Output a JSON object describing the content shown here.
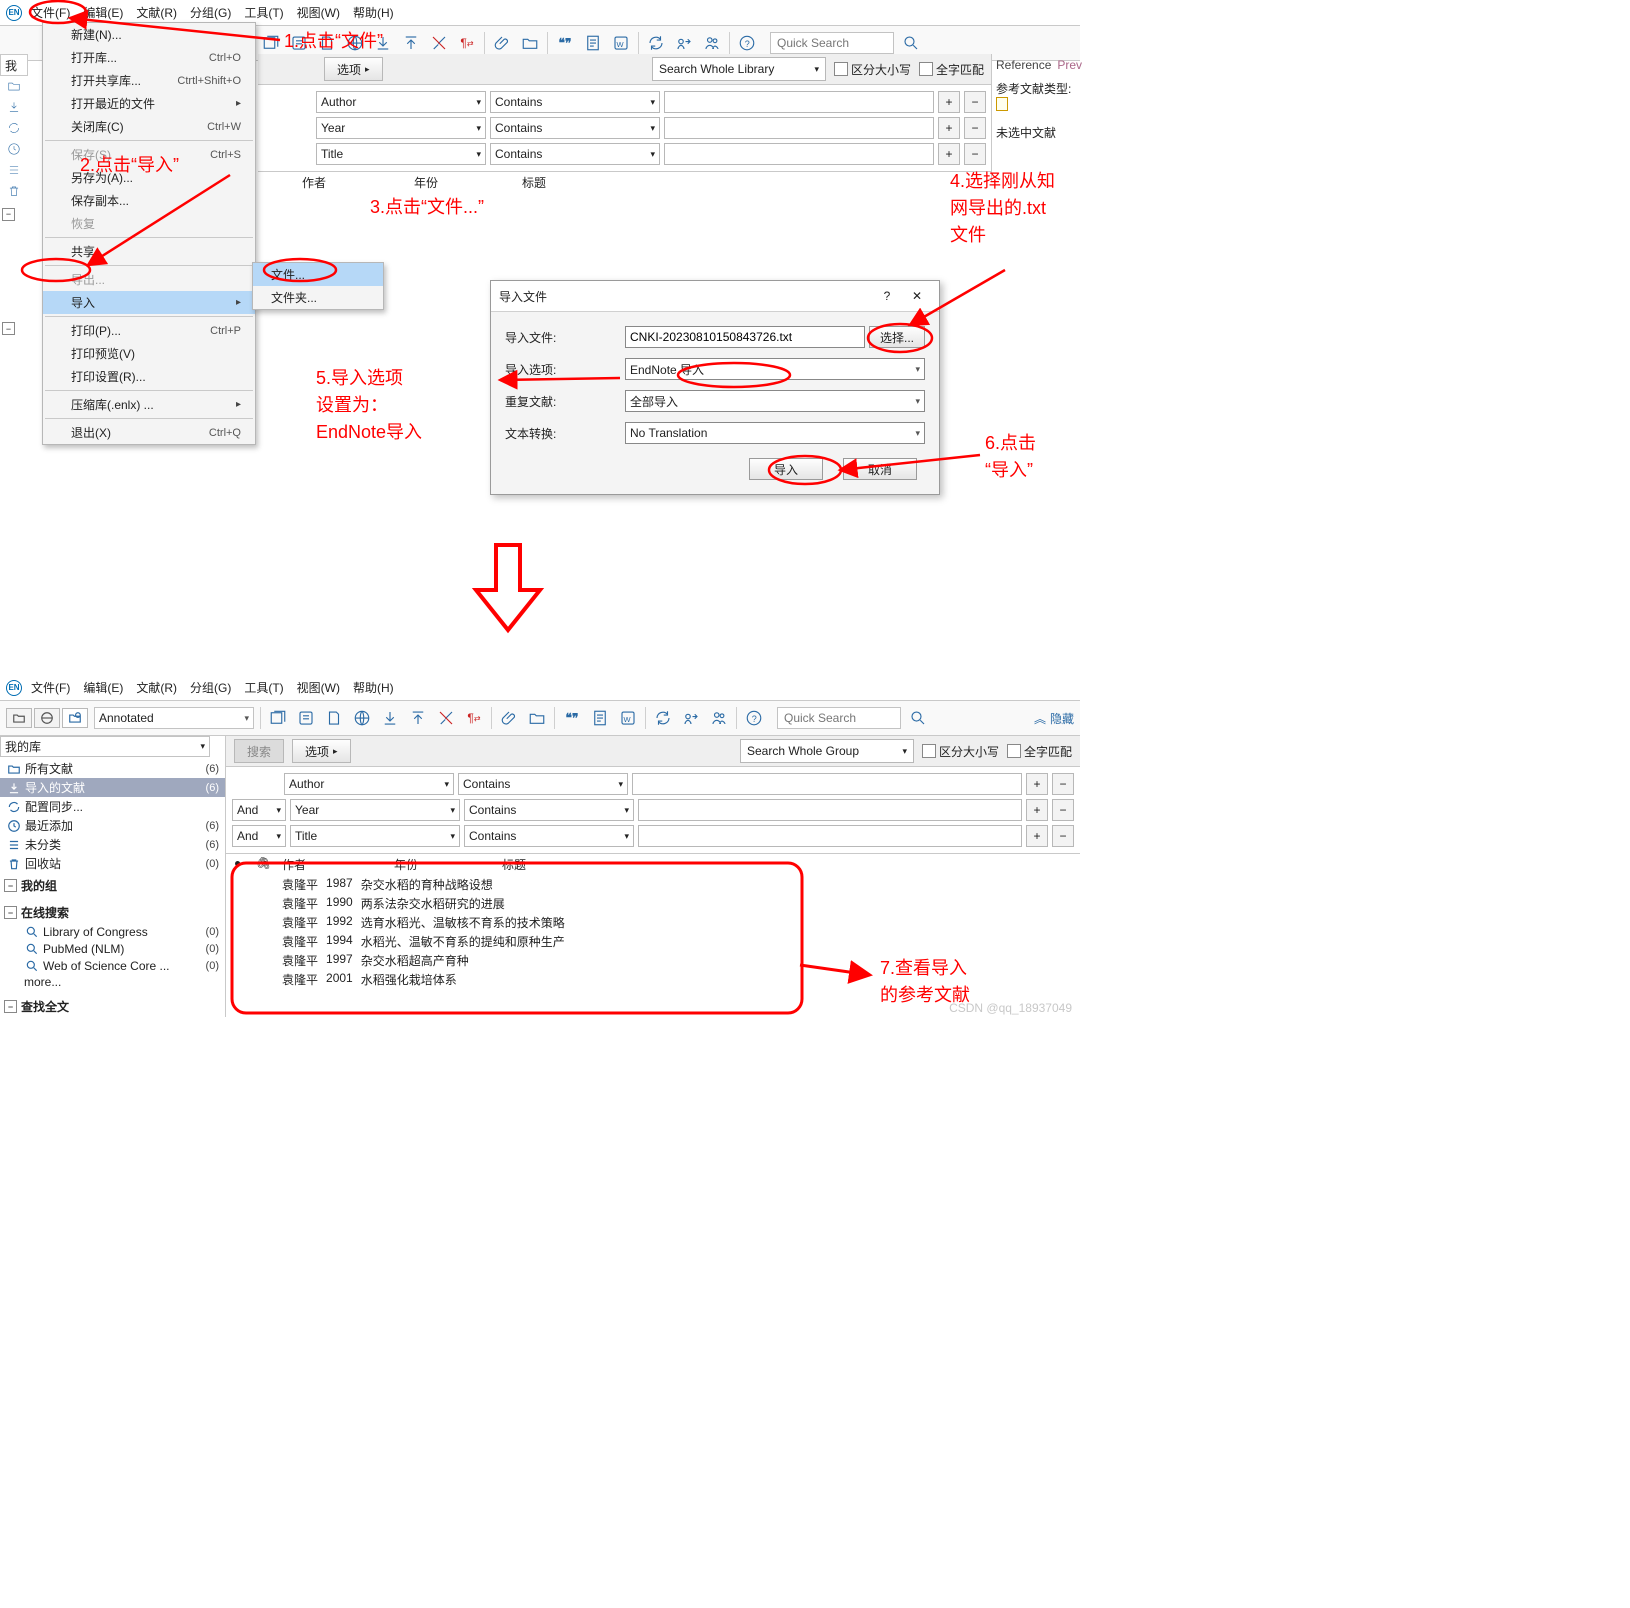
{
  "menus": {
    "file": "文件(F)",
    "edit": "编辑(E)",
    "refs": "文献(R)",
    "group": "分组(G)",
    "tools": "工具(T)",
    "window": "视图(W)",
    "help": "帮助(H)"
  },
  "mode_label": "Annotated",
  "quick_search_placeholder": "Quick Search",
  "file_menu": {
    "new": "新建(N)...",
    "open": "打开库...",
    "open_shared": "打开共享库...",
    "open_recent": "打开最近的文件",
    "close": "关闭库(C)",
    "save": "保存(S)",
    "saveas": "另存为(A)...",
    "savecopy": "保存副本...",
    "revert": "恢复",
    "share": "共享...",
    "export": "导出...",
    "import": "导入",
    "print": "打印(P)...",
    "print_preview": "打印预览(V)",
    "page_setup": "打印设置(R)...",
    "compress": "压缩库(.enlx) ...",
    "exit": "退出(X)",
    "sc_open": "Ctrl+O",
    "sc_open_shared": "Ctrtl+Shift+O",
    "sc_close": "Ctrl+W",
    "sc_save": "Ctrl+S",
    "sc_print": "Ctrl+P",
    "sc_exit": "Ctrl+Q"
  },
  "submenu": {
    "file": "文件...",
    "folder": "文件夹..."
  },
  "searchbar": {
    "search_btn": "搜索",
    "options_btn": "选项",
    "scope1": "Search Whole Library",
    "scope2": "Search Whole Group",
    "match_case": "区分大小写",
    "match_word": "全字匹配"
  },
  "criteria": {
    "field1": "Author",
    "field2": "Year",
    "field3": "Title",
    "op": "Contains",
    "and": "And"
  },
  "columns": {
    "c0": "",
    "attach": "📎",
    "author": "作者",
    "year": "年份",
    "title": "标题"
  },
  "refpane": {
    "tab_ref": "Reference",
    "tab_prev": "Prev",
    "ref_type": "参考文献类型:",
    "no_sel": "未选中文献"
  },
  "dialog": {
    "title": "导入文件",
    "lbl_file": "导入文件:",
    "lbl_opt": "导入选项:",
    "lbl_dup": "重复文献:",
    "lbl_trans": "文本转换:",
    "file_value": "CNKI-20230810150843726.txt",
    "choose": "选择...",
    "opt_value": "EndNote 导入",
    "dup_value": "全部导入",
    "trans_value": "No Translation",
    "btn_import": "导入",
    "btn_cancel": "取消",
    "qmark": "?",
    "close": "✕"
  },
  "annotations": {
    "a1": "1.点击“文件”",
    "a2": "2.点击“导入”",
    "a3": "3.点击“文件...”",
    "a4_l1": "4.选择刚从知",
    "a4_l2": "网导出的.txt",
    "a4_l3": "文件",
    "a5_l1": "5.导入选项",
    "a5_l2": "设置为：",
    "a5_l3": "EndNote导入",
    "a6_l1": "6.点击",
    "a6_l2": "“导入”",
    "a7_l1": "7.查看导入",
    "a7_l2": "的参考文献"
  },
  "sidebar": {
    "mylib": "我的库",
    "hide": "隐藏",
    "items": [
      {
        "icon": "all",
        "label": "所有文献",
        "cnt": "(6)"
      },
      {
        "icon": "imported",
        "label": "导入的文献",
        "cnt": "(6)",
        "sel": true
      },
      {
        "icon": "sync",
        "label": "配置同步..."
      },
      {
        "icon": "recent",
        "label": "最近添加",
        "cnt": "(6)"
      },
      {
        "icon": "unfiled",
        "label": "未分类",
        "cnt": "(6)"
      },
      {
        "icon": "trash",
        "label": "回收站",
        "cnt": "(0)"
      }
    ],
    "mygroups": "我的组",
    "online": "在线搜索",
    "more": "more...",
    "findft": "查找全文",
    "online_items": [
      {
        "label": "Library of Congress",
        "cnt": "(0)"
      },
      {
        "label": "PubMed (NLM)",
        "cnt": "(0)"
      },
      {
        "label": "Web of Science Core ...",
        "cnt": "(0)"
      }
    ]
  },
  "records": [
    {
      "author": "袁隆平",
      "year": "1987",
      "title": "杂交水稻的育种战略设想"
    },
    {
      "author": "袁隆平",
      "year": "1990",
      "title": "两系法杂交水稻研究的进展"
    },
    {
      "author": "袁隆平",
      "year": "1992",
      "title": "选育水稻光、温敏核不育系的技术策略"
    },
    {
      "author": "袁隆平",
      "year": "1994",
      "title": "水稻光、温敏不育系的提纯和原种生产"
    },
    {
      "author": "袁隆平",
      "year": "1997",
      "title": "杂交水稻超高产育种"
    },
    {
      "author": "袁隆平",
      "year": "2001",
      "title": "水稻强化栽培体系"
    }
  ],
  "watermark": "CSDN @qq_18937049"
}
